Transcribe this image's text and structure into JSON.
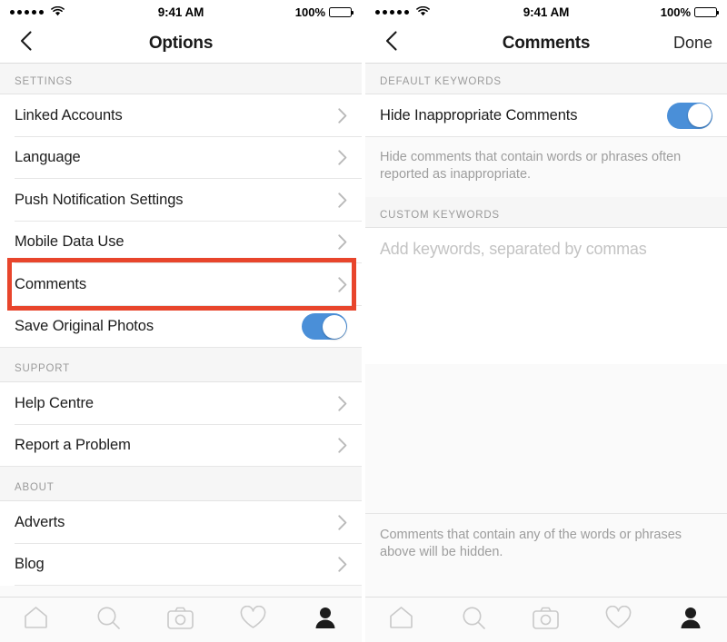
{
  "status_bar": {
    "signal_dots": 5,
    "wifi_icon": "wifi-icon",
    "time": "9:41 AM",
    "battery_percent": "100%",
    "battery_icon": "battery-full-icon"
  },
  "left_screen": {
    "nav": {
      "back_icon": "chevron-left-icon",
      "title": "Options"
    },
    "sections": [
      {
        "header": "SETTINGS",
        "rows": [
          {
            "label": "Linked Accounts",
            "accessory": "chevron",
            "highlighted": false
          },
          {
            "label": "Language",
            "accessory": "chevron",
            "highlighted": false
          },
          {
            "label": "Push Notification Settings",
            "accessory": "chevron",
            "highlighted": false
          },
          {
            "label": "Mobile Data Use",
            "accessory": "chevron",
            "highlighted": false
          },
          {
            "label": "Comments",
            "accessory": "chevron",
            "highlighted": true
          },
          {
            "label": "Save Original Photos",
            "accessory": "toggle",
            "toggle_on": true,
            "highlighted": false
          }
        ]
      },
      {
        "header": "SUPPORT",
        "rows": [
          {
            "label": "Help Centre",
            "accessory": "chevron",
            "highlighted": false
          },
          {
            "label": "Report a Problem",
            "accessory": "chevron",
            "highlighted": false
          }
        ]
      },
      {
        "header": "ABOUT",
        "rows": [
          {
            "label": "Adverts",
            "accessory": "chevron",
            "highlighted": false
          },
          {
            "label": "Blog",
            "accessory": "chevron",
            "highlighted": false
          }
        ]
      }
    ]
  },
  "right_screen": {
    "nav": {
      "back_icon": "chevron-left-icon",
      "title": "Comments",
      "done_label": "Done"
    },
    "default_keywords": {
      "header": "DEFAULT KEYWORDS",
      "row_label": "Hide Inappropriate Comments",
      "toggle_on": true,
      "description": "Hide comments that contain words or phrases often reported as inappropriate."
    },
    "custom_keywords": {
      "header": "CUSTOM KEYWORDS",
      "input_value": "",
      "input_placeholder": "Add keywords, separated by commas",
      "footer_note": "Comments that contain any of the words or phrases above will be hidden."
    }
  },
  "tab_bar": {
    "items": [
      {
        "icon": "home-icon",
        "active": false
      },
      {
        "icon": "search-icon",
        "active": false
      },
      {
        "icon": "camera-icon",
        "active": false
      },
      {
        "icon": "heart-icon",
        "active": false
      },
      {
        "icon": "profile-icon",
        "active": true
      }
    ]
  },
  "colors": {
    "highlight_red": "#e8452c",
    "toggle_blue": "#4a8fd8",
    "section_header_text": "#9a9a9a",
    "muted_text": "#9d9d9d"
  }
}
